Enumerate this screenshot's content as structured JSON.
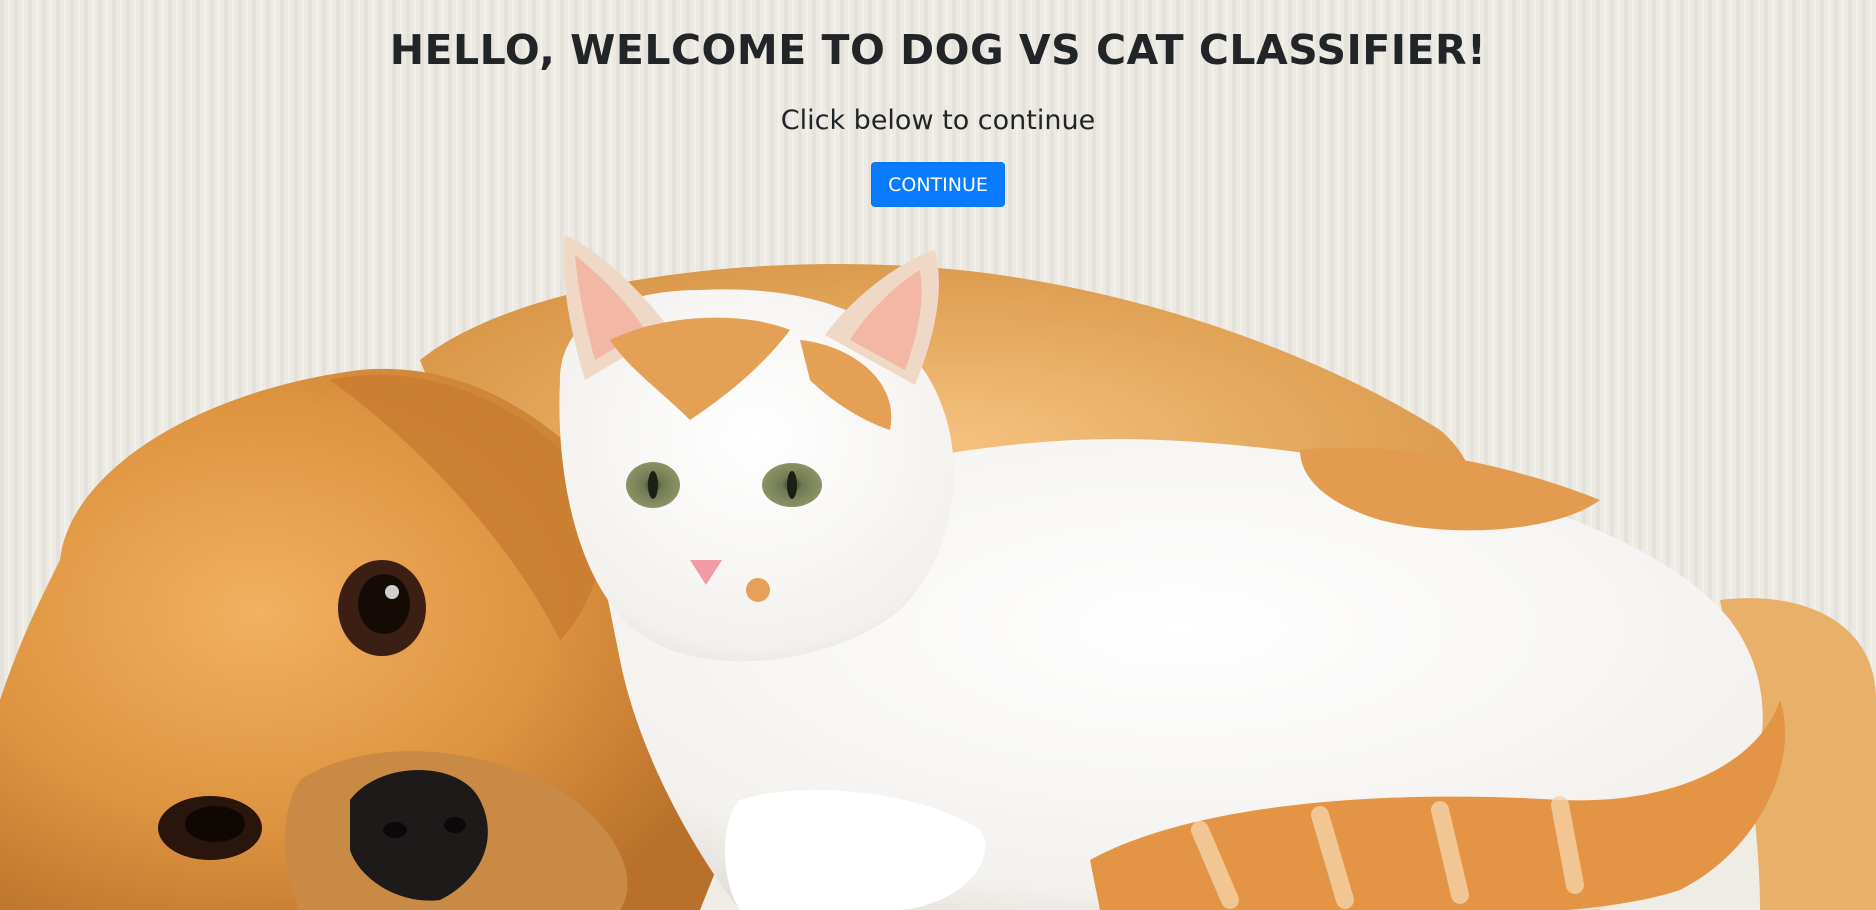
{
  "hero": {
    "title": "HELLO, WELCOME TO DOG VS CAT CLASSIFIER!",
    "subtitle": "Click below to continue",
    "continue_label": "CONTINUE"
  },
  "colors": {
    "button": "#0a7bff",
    "heading": "#222528",
    "background_wall": "#ece8e1"
  }
}
